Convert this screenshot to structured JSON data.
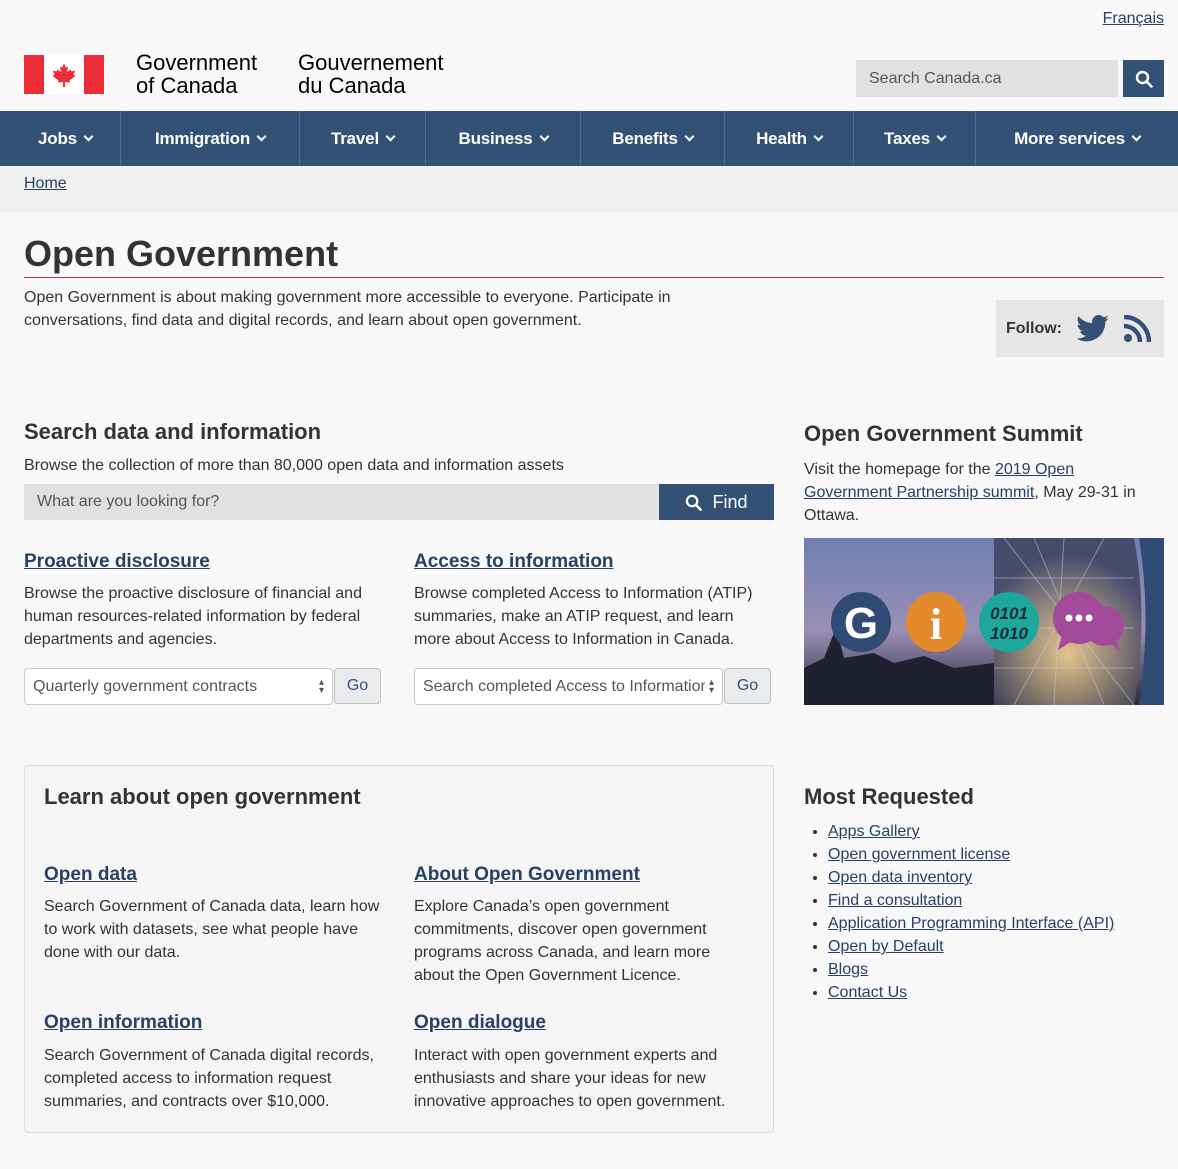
{
  "header": {
    "language_link": "Français",
    "signature_en_line1": "Government",
    "signature_en_line2": "of Canada",
    "signature_fr_line1": "Gouvernement",
    "signature_fr_line2": "du Canada",
    "search_placeholder": "Search Canada.ca",
    "flag_colors": {
      "red": "#eb2d37",
      "white": "#ffffff"
    }
  },
  "menu": {
    "items": [
      {
        "label": "Jobs"
      },
      {
        "label": "Immigration"
      },
      {
        "label": "Travel"
      },
      {
        "label": "Business"
      },
      {
        "label": "Benefits"
      },
      {
        "label": "Health"
      },
      {
        "label": "Taxes"
      },
      {
        "label": "More services"
      }
    ],
    "color": "#335075"
  },
  "breadcrumb": {
    "home": "Home"
  },
  "page": {
    "title": "Open Government",
    "intro": "Open Government is about making government more accessible to everyone. Participate in conversations, find data and digital records, and learn about open government.",
    "follow_label": "Follow:",
    "follow_icons": [
      "twitter-icon",
      "rss-icon"
    ]
  },
  "search_section": {
    "heading": "Search data and information",
    "description": "Browse the collection of more than 80,000 open data and information assets",
    "input_placeholder": "What are you looking for?",
    "button_label": "Find"
  },
  "proactive": {
    "title": "Proactive disclosure",
    "text": "Browse the proactive disclosure of financial and human resources-related information by federal departments and agencies.",
    "select_value": "Quarterly government contracts",
    "go": "Go"
  },
  "ati": {
    "title": "Access to information",
    "text": "Browse completed Access to Information (ATIP) summaries, make an ATIP request, and learn more about Access to Information in Canada.",
    "select_value": "Search completed Access to Information",
    "go": "Go"
  },
  "summit": {
    "heading": "Open Government Summit",
    "text_before": "Visit the homepage for the ",
    "link": "2019 Open Government Partnership summit",
    "text_after": ", May 29-31 in Ottawa.",
    "badge_text": "0101 1010"
  },
  "learn": {
    "heading": "Learn about open government",
    "items": [
      {
        "title": "Open data",
        "text": "Search Government of Canada data, learn how to work with datasets, see what people have done with our data."
      },
      {
        "title": "About Open Government",
        "text": "Explore Canada’s open government commitments, discover open government programs across Canada, and learn more about the Open Government Licence."
      },
      {
        "title": "Open information",
        "text": "Search Government of Canada digital records, completed access to information request summaries, and contracts over $10,000."
      },
      {
        "title": "Open dialogue",
        "text": "Interact with open government experts and enthusiasts and share your ideas for new innovative approaches to open government."
      }
    ]
  },
  "most_requested": {
    "heading": "Most Requested",
    "links": [
      "Apps Gallery",
      "Open government license",
      "Open data inventory",
      "Find a consultation",
      "Application Programming Interface (API)",
      "Open by Default",
      "Blogs",
      "Contact Us"
    ]
  }
}
